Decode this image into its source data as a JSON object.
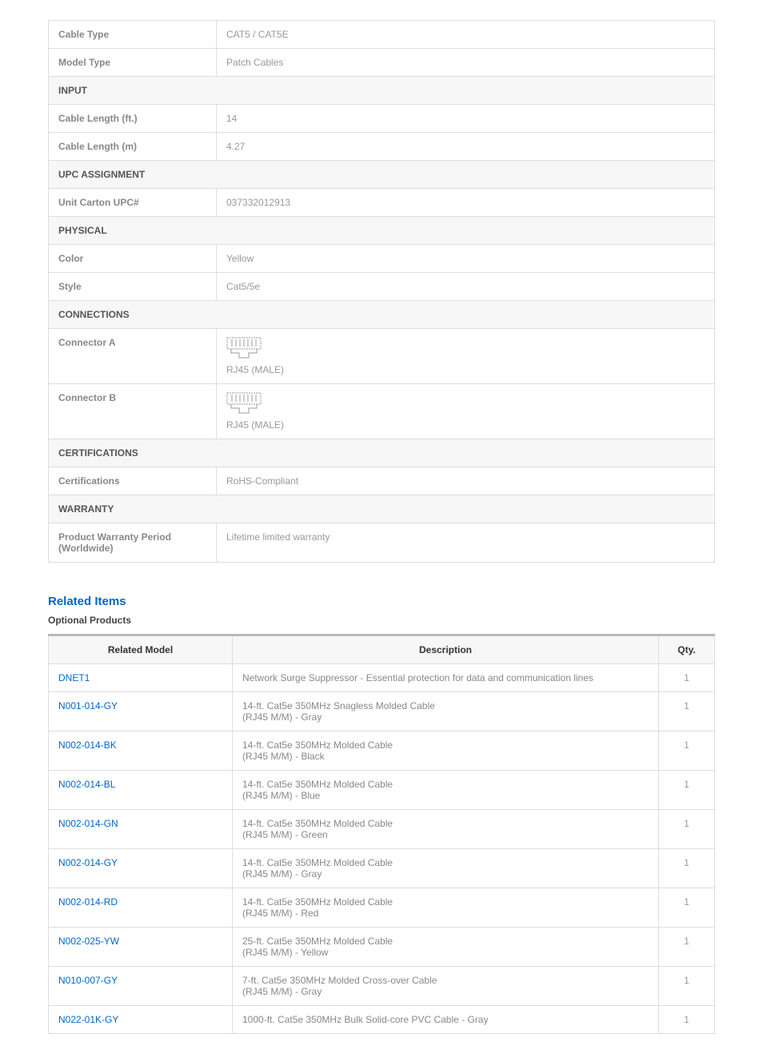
{
  "specs": {
    "cable_type": {
      "label": "Cable Type",
      "value": "CAT5 / CAT5E"
    },
    "model_type": {
      "label": "Model Type",
      "value": "Patch Cables"
    },
    "section_input": "INPUT",
    "cable_length_ft": {
      "label": "Cable Length (ft.)",
      "value": "14"
    },
    "cable_length_m": {
      "label": "Cable Length (m)",
      "value": "4.27"
    },
    "section_upc": "UPC ASSIGNMENT",
    "unit_carton_upc": {
      "label": "Unit Carton UPC#",
      "value": "037332012913"
    },
    "section_physical": "PHYSICAL",
    "color": {
      "label": "Color",
      "value": "Yellow"
    },
    "style": {
      "label": "Style",
      "value": "Cat5/5e"
    },
    "section_connections": "CONNECTIONS",
    "connector_a": {
      "label": "Connector A",
      "value": "RJ45 (MALE)"
    },
    "connector_b": {
      "label": "Connector B",
      "value": "RJ45 (MALE)"
    },
    "section_certifications": "CERTIFICATIONS",
    "certifications": {
      "label": "Certifications",
      "value": "RoHS-Compliant"
    },
    "section_warranty": "WARRANTY",
    "warranty_period": {
      "label": "Product Warranty Period (Worldwide)",
      "value": "Lifetime limited warranty"
    }
  },
  "related": {
    "title": "Related Items",
    "subtitle": "Optional Products",
    "headers": {
      "model": "Related Model",
      "description": "Description",
      "qty": "Qty."
    },
    "items": [
      {
        "model": "DNET1",
        "description": "Network Surge Suppressor - Essential protection for data and communication lines",
        "qty": "1"
      },
      {
        "model": "N001-014-GY",
        "description": "14-ft. Cat5e 350MHz Snagless Molded Cable\n(RJ45 M/M) - Gray",
        "qty": "1"
      },
      {
        "model": "N002-014-BK",
        "description": "14-ft. Cat5e 350MHz Molded Cable\n(RJ45 M/M) - Black",
        "qty": "1"
      },
      {
        "model": "N002-014-BL",
        "description": "14-ft. Cat5e 350MHz Molded Cable\n(RJ45 M/M) - Blue",
        "qty": "1"
      },
      {
        "model": "N002-014-GN",
        "description": "14-ft. Cat5e 350MHz Molded Cable\n(RJ45 M/M) - Green",
        "qty": "1"
      },
      {
        "model": "N002-014-GY",
        "description": "14-ft. Cat5e 350MHz Molded Cable\n(RJ45 M/M) - Gray",
        "qty": "1"
      },
      {
        "model": "N002-014-RD",
        "description": "14-ft. Cat5e 350MHz Molded Cable\n(RJ45 M/M) - Red",
        "qty": "1"
      },
      {
        "model": "N002-025-YW",
        "description": "25-ft. Cat5e 350MHz Molded Cable\n(RJ45 M/M) - Yellow",
        "qty": "1"
      },
      {
        "model": "N010-007-GY",
        "description": "7-ft. Cat5e 350MHz Molded Cross-over Cable\n(RJ45 M/M) - Gray",
        "qty": "1"
      },
      {
        "model": "N022-01K-GY",
        "description": "1000-ft. Cat5e 350MHz Bulk Solid-core PVC Cable - Gray",
        "qty": "1"
      }
    ]
  }
}
